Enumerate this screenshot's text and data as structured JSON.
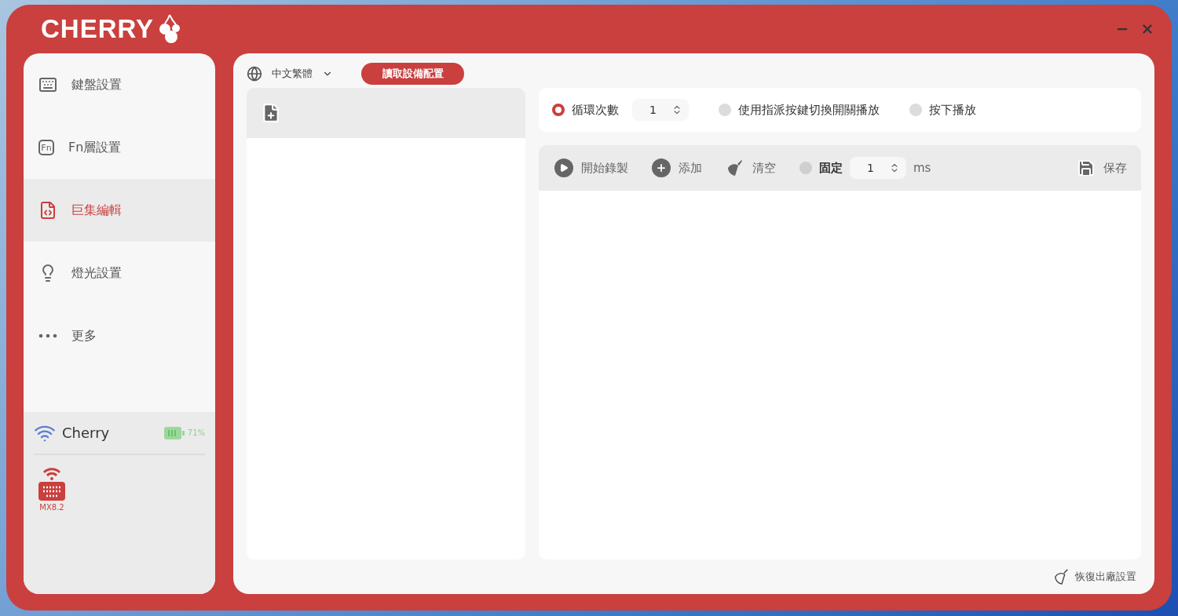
{
  "app": {
    "logo": "CHERRY"
  },
  "sidebar": {
    "items": [
      {
        "kind": "keyboard",
        "label": "鍵盤設置",
        "selected": false
      },
      {
        "kind": "fn",
        "icon_text": "Fn",
        "label": "Fn層設置",
        "selected": false
      },
      {
        "kind": "macro",
        "label": "巨集編輯",
        "selected": true
      },
      {
        "kind": "light",
        "label": "燈光設置",
        "selected": false
      },
      {
        "kind": "more",
        "label": "更多",
        "selected": false
      }
    ]
  },
  "connection": {
    "name": "Cherry",
    "battery": "71%",
    "devices": [
      {
        "label": "MX8.2"
      }
    ]
  },
  "top_bar": {
    "language": "中文繁體",
    "read_button": "讀取設備配置"
  },
  "playback_options": [
    {
      "kind": "count",
      "label": "循環次數",
      "selected": true,
      "value": "1"
    },
    {
      "kind": "plain",
      "label": "使用指派按鍵切換開關播放",
      "selected": false
    },
    {
      "kind": "plain",
      "label": "按下播放",
      "selected": false
    }
  ],
  "recorder": {
    "actions": [
      {
        "kind": "record",
        "label": "開始錄製"
      },
      {
        "kind": "add",
        "label": "添加"
      },
      {
        "kind": "clear",
        "label": "清空"
      }
    ],
    "fixed_delay": {
      "label": "固定",
      "selected": false,
      "value": "1",
      "unit": "ms"
    },
    "save": "保存"
  },
  "footer": {
    "reset": "恢復出廠設置"
  }
}
